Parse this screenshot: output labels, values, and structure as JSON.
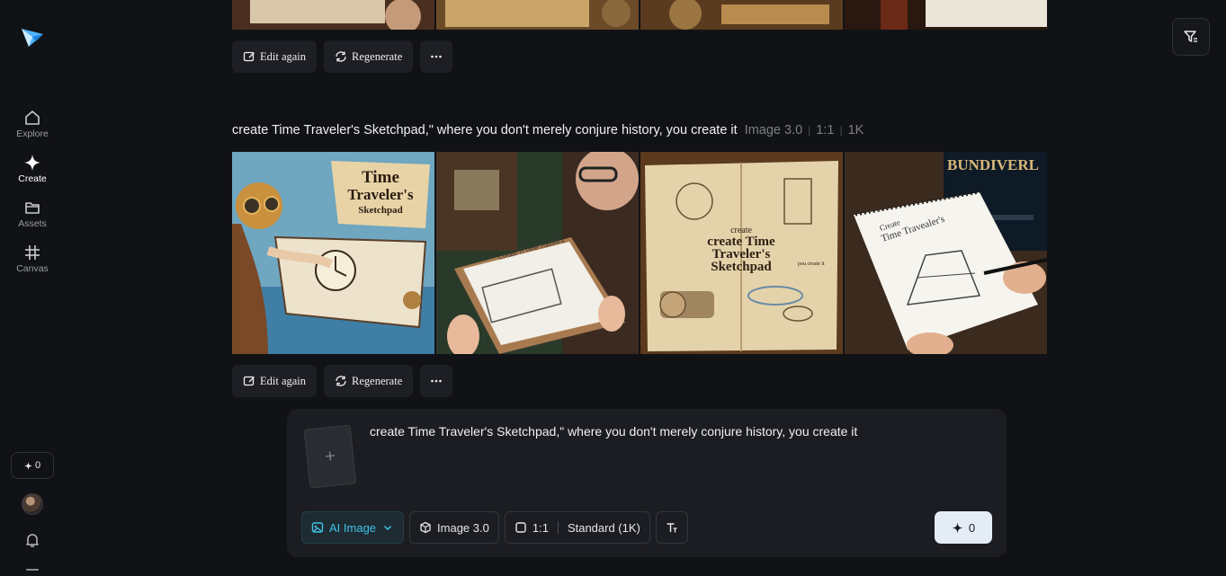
{
  "sidebar": {
    "nav": [
      {
        "label": "Explore",
        "icon": "home-icon"
      },
      {
        "label": "Create",
        "icon": "sparkle-icon"
      },
      {
        "label": "Assets",
        "icon": "folder-icon"
      },
      {
        "label": "Canvas",
        "icon": "canvas-icon"
      }
    ],
    "credits": "0"
  },
  "top_actions": {
    "edit_again": "Edit again",
    "regenerate": "Regenerate"
  },
  "generation": {
    "prompt": "create Time Traveler's Sketchpad,\" where you don't merely conjure history, you create it",
    "model": "Image 3.0",
    "ratio": "1:1",
    "resolution": "1K",
    "image_texts": {
      "img1_title_1": "Time",
      "img1_title_2": "Traveler's",
      "img1_title_3": "Sketchpad",
      "img2_title": "Create Ti Time Travele's",
      "img3_title_1": "create",
      "img3_title_2": "create Time",
      "img3_title_3": "Traveler's",
      "img3_title_4": "Sketchpad",
      "img3_small": "pou create it",
      "img4_title_1": "Create",
      "img4_title_2": "Time Travealer's",
      "img4_sign": "BUNDIVERL"
    }
  },
  "bottom_actions": {
    "edit_again": "Edit again",
    "regenerate": "Regenerate"
  },
  "composer": {
    "upload_symbol": "+",
    "text": "create Time Traveler's Sketchpad,\" where you don't merely conjure history, you create it",
    "mode": "AI Image",
    "model": "Image 3.0",
    "ratio": "1:1",
    "quality": "Standard (1K)",
    "generate_cost": "0"
  },
  "colors": {
    "accent": "#3fc3e8",
    "background": "#111215",
    "panel": "#1c1d22"
  }
}
